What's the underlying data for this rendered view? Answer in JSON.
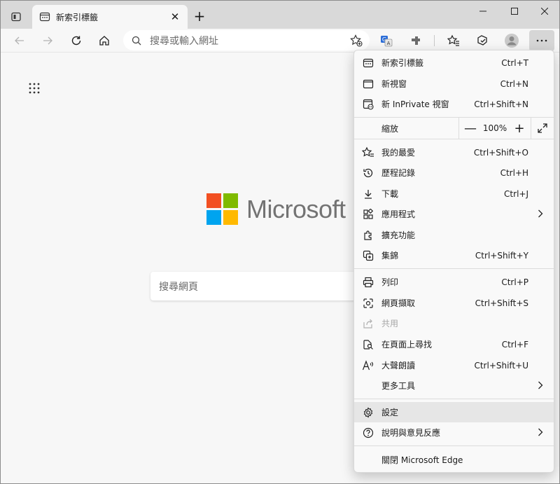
{
  "tab": {
    "title": "新索引標籤",
    "favicon_icon": "new-tab-icon",
    "close_symbol": "✕"
  },
  "newtab_symbol": "+",
  "address": {
    "placeholder": "搜尋或輸入網址"
  },
  "content": {
    "logo_text": "Microsoft",
    "logo_colors": [
      "#f25022",
      "#7fba00",
      "#00a4ef",
      "#ffb900"
    ],
    "search_placeholder": "搜尋網頁"
  },
  "menu": {
    "items": [
      {
        "label": "新索引標籤",
        "shortcut": "Ctrl+T",
        "icon": "new-tab-icon"
      },
      {
        "label": "新視窗",
        "shortcut": "Ctrl+N",
        "icon": "new-window-icon"
      },
      {
        "label": "新 InPrivate 視窗",
        "shortcut": "Ctrl+Shift+N",
        "icon": "inprivate-icon"
      },
      {
        "label": "我的最愛",
        "shortcut": "Ctrl+Shift+O",
        "icon": "favorites-icon"
      },
      {
        "label": "歷程記錄",
        "shortcut": "Ctrl+H",
        "icon": "history-icon"
      },
      {
        "label": "下載",
        "shortcut": "Ctrl+J",
        "icon": "download-icon"
      },
      {
        "label": "應用程式",
        "shortcut": "",
        "icon": "apps-icon"
      },
      {
        "label": "擴充功能",
        "shortcut": "",
        "icon": "extensions-icon"
      },
      {
        "label": "集錦",
        "shortcut": "Ctrl+Shift+Y",
        "icon": "collections-icon"
      },
      {
        "label": "列印",
        "shortcut": "Ctrl+P",
        "icon": "print-icon"
      },
      {
        "label": "網頁擷取",
        "shortcut": "Ctrl+Shift+S",
        "icon": "web-capture-icon"
      },
      {
        "label": "共用",
        "shortcut": "",
        "icon": "share-icon"
      },
      {
        "label": "在頁面上尋找",
        "shortcut": "Ctrl+F",
        "icon": "find-icon"
      },
      {
        "label": "大聲朗讀",
        "shortcut": "Ctrl+Shift+U",
        "icon": "read-aloud-icon"
      },
      {
        "label": "更多工具",
        "shortcut": "",
        "icon": ""
      },
      {
        "label": "設定",
        "shortcut": "",
        "icon": "settings-icon"
      },
      {
        "label": "說明與意見反應",
        "shortcut": "",
        "icon": "help-icon"
      },
      {
        "label": "關閉 Microsoft Edge",
        "shortcut": "",
        "icon": ""
      }
    ],
    "zoom": {
      "label": "縮放",
      "value": "100%",
      "minus": "—",
      "plus": "+"
    },
    "disabled_item": "共用",
    "highlighted_item": "設定"
  }
}
